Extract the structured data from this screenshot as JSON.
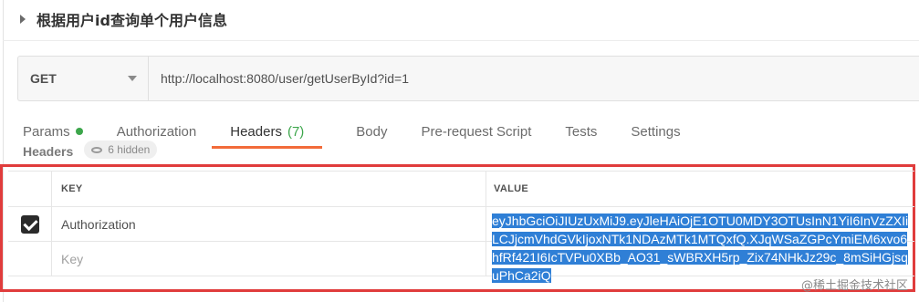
{
  "request": {
    "title": "根据用户id查询单个用户信息"
  },
  "urlbar": {
    "method": "GET",
    "url": "http://localhost:8080/user/getUserById?id=1"
  },
  "tabs": [
    {
      "label": "Params"
    },
    {
      "label": "Authorization"
    },
    {
      "label": "Headers",
      "count": "(7)"
    },
    {
      "label": "Body"
    },
    {
      "label": "Pre-request Script"
    },
    {
      "label": "Tests"
    },
    {
      "label": "Settings"
    }
  ],
  "subheader": {
    "title": "Headers",
    "hidden": "6 hidden"
  },
  "table": {
    "key_header": "KEY",
    "value_header": "VALUE",
    "rows": [
      {
        "key": "Authorization",
        "checked": true,
        "value": "eyJhbGciOiJIUzUxMiJ9.eyJleHAiOjE1OTU0MDY3OTUsInN1YiI6InVzZXIiLCJjcmVhdGVkIjoxNTk1NDAzMTk1MTQxfQ.XJqWSaZGPcYmiEM6xvo6hfRf421I6IcTVPu0XBb_AO31_sWBRXH5rp_Zix74NHkJz29c_8mSiHGjsquPhCa2iQ"
      }
    ],
    "new_row_placeholder": "Key"
  },
  "watermark": "@稀土掘金技术社区",
  "colors": {
    "accent": "#f26b3a",
    "highlight_frame": "#e03c3c",
    "selection": "#2f7fd6",
    "status_dot": "#3ca64b"
  }
}
